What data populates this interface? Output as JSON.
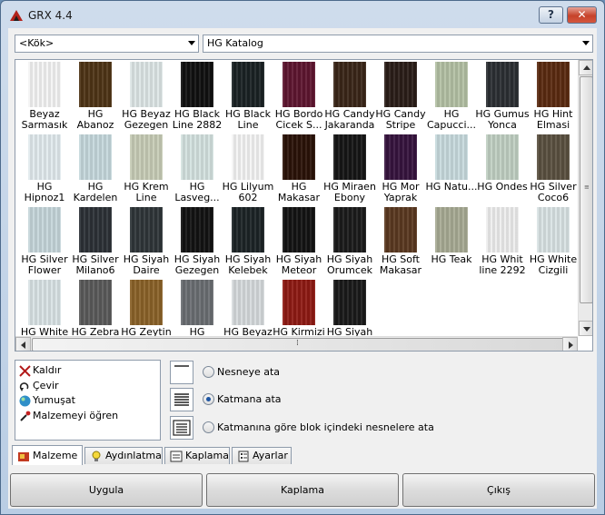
{
  "window": {
    "title": "GRX 4.4",
    "help_label": "?",
    "close_label": "✕"
  },
  "combos": {
    "folder": "<Kök>",
    "catalog": "HG Katalog"
  },
  "materials": [
    {
      "label": "Beyaz Sarmasık",
      "color": "#f4f4f4"
    },
    {
      "label": "HG Abanoz",
      "color": "#4e3416"
    },
    {
      "label": "HG Beyaz Gezegen",
      "color": "#dde6e6"
    },
    {
      "label": "HG Black Line 2882",
      "color": "#101010"
    },
    {
      "label": "HG Black Line",
      "color": "#1a2224"
    },
    {
      "label": "HG Bordo Cicek S...",
      "color": "#5e1630"
    },
    {
      "label": "HG Candy Jakaranda",
      "color": "#3a2618"
    },
    {
      "label": "HG Candy Stripe",
      "color": "#2a1d18"
    },
    {
      "label": "HG Capucci...",
      "color": "#b3c0a4"
    },
    {
      "label": "HG Gumus Yonca",
      "color": "#2b2f33"
    },
    {
      "label": "HG Hint Elmasi",
      "color": "#5a2a10"
    },
    {
      "label": "HG Hipnoz1",
      "color": "#e2eaee"
    },
    {
      "label": "HG Kardelen",
      "color": "#c6d8dc"
    },
    {
      "label": "HG Krem Line",
      "color": "#c7ccb6"
    },
    {
      "label": "HG Lasveg...",
      "color": "#d4e2e0"
    },
    {
      "label": "HG Lilyum 602",
      "color": "#f4f4f4"
    },
    {
      "label": "HG Makasar",
      "color": "#2a1208"
    },
    {
      "label": "HG Miraen Ebony",
      "color": "#161616"
    },
    {
      "label": "HG Mor Yaprak",
      "color": "#36143e"
    },
    {
      "label": "HG Natu...",
      "color": "#c8dadd"
    },
    {
      "label": "HG Ondes",
      "color": "#c0cfc2"
    },
    {
      "label": "HG Silver Coco6",
      "color": "#5a5040"
    },
    {
      "label": "HG Silver Flower",
      "color": "#c6d6da"
    },
    {
      "label": "HG Silver Milano6",
      "color": "#2c3136"
    },
    {
      "label": "HG Siyah Daire",
      "color": "#2f3538"
    },
    {
      "label": "HG Siyah Gezegen",
      "color": "#121212"
    },
    {
      "label": "HG Siyah Kelebek",
      "color": "#1c2426"
    },
    {
      "label": "HG Siyah Meteor",
      "color": "#141414"
    },
    {
      "label": "HG Siyah Orumcek",
      "color": "#1b1b1b"
    },
    {
      "label": "HG Soft Makasar",
      "color": "#5a3820"
    },
    {
      "label": "HG Teak",
      "color": "#a7aa94"
    },
    {
      "label": "HG Whit line 2292",
      "color": "#eeeeee"
    },
    {
      "label": "HG White Cizgili",
      "color": "#d9e3e4"
    },
    {
      "label": "HG White",
      "color": "#d9e3e5"
    },
    {
      "label": "HG Zebra",
      "color": "#5a5a5a"
    },
    {
      "label": "HG Zeytin",
      "color": "#8a6228"
    },
    {
      "label": "HG",
      "color": "#6a6e72"
    },
    {
      "label": "HG Beyaz",
      "color": "#d6dadc"
    },
    {
      "label": "HG Kirmizi",
      "color": "#8e1a14"
    },
    {
      "label": "HG Siyah",
      "color": "#1a1a1a"
    }
  ],
  "commands": [
    {
      "label": "Kaldır",
      "icon": "remove-x-icon"
    },
    {
      "label": "Çevir",
      "icon": "rotate-icon"
    },
    {
      "label": "Yumuşat",
      "icon": "smooth-sphere-icon"
    },
    {
      "label": "Malzemeyi öğren",
      "icon": "eyedropper-icon"
    }
  ],
  "assign_options": [
    {
      "label": "Nesneye ata",
      "selected": false,
      "icon": "single-line-icon"
    },
    {
      "label": "Katmana ata",
      "selected": true,
      "icon": "multi-line-icon"
    },
    {
      "label": "Katmanına göre blok içindeki nesnelere ata",
      "selected": false,
      "icon": "block-lines-icon"
    }
  ],
  "tabs": [
    {
      "label": "Malzeme",
      "icon": "material-icon",
      "active": true
    },
    {
      "label": "Aydınlatma",
      "icon": "lightbulb-icon",
      "active": false
    },
    {
      "label": "Kaplama",
      "icon": "mapping-icon",
      "active": false
    },
    {
      "label": "Ayarlar",
      "icon": "settings-icon",
      "active": false
    }
  ],
  "buttons": {
    "apply": "Uygula",
    "mapping": "Kaplama",
    "exit": "Çıkış"
  }
}
